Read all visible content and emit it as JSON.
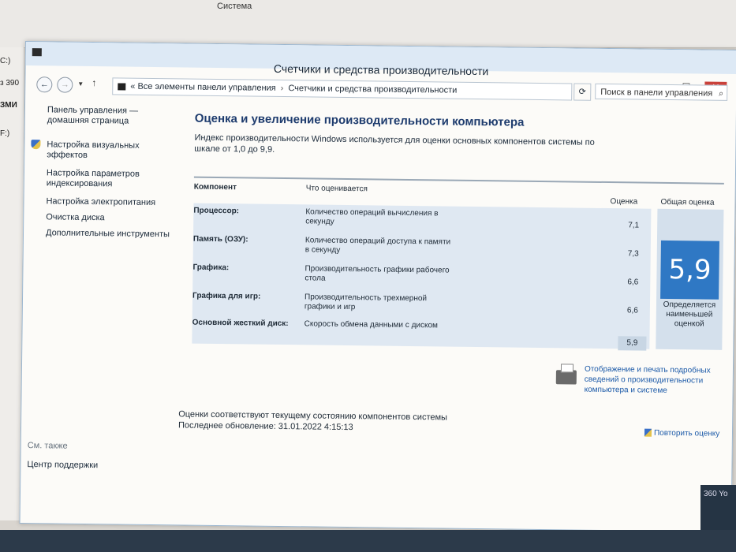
{
  "background": {
    "title": "Система",
    "fragments": [
      "C:)",
      "з 390",
      "ЗМИ",
      "F:)"
    ]
  },
  "corner_badge": "360 Yo",
  "window": {
    "title": "Счетчики и средства производительности",
    "controls": {
      "minimize": "–",
      "maximize": "☐",
      "close": "✕"
    }
  },
  "nav": {
    "back": "←",
    "forward": "→",
    "up": "↑",
    "breadcrumb_prefix": "«",
    "breadcrumb": [
      "Все элементы панели управления",
      "Счетчики и средства производительности"
    ],
    "search_placeholder": "Поиск в панели управления"
  },
  "sidebar": {
    "home": "Панель управления — домашняя страница",
    "items": [
      "Настройка визуальных эффектов",
      "Настройка параметров индексирования",
      "Настройка электропитания",
      "Очистка диска",
      "Дополнительные инструменты"
    ],
    "see_also": "См. также",
    "support": "Центр поддержки"
  },
  "main": {
    "title": "Оценка и увеличение производительности компьютера",
    "intro": "Индекс производительности Windows используется для оценки основных компонентов системы по шкале от 1,0 до 9,9.",
    "table": {
      "headers": {
        "component": "Компонент",
        "rated": "Что оценивается",
        "score": "Оценка",
        "overall": "Общая оценка"
      },
      "rows": [
        {
          "name": "Процессор:",
          "desc": "Количество операций вычисления в секунду",
          "score": "7,1"
        },
        {
          "name": "Память (ОЗУ):",
          "desc": "Количество операций доступа к памяти в секунду",
          "score": "7,3"
        },
        {
          "name": "Графика:",
          "desc": "Производительность графики рабочего стола",
          "score": "6,6"
        },
        {
          "name": "Графика для игр:",
          "desc": "Производительность трехмерной графики и игр",
          "score": "6,6"
        },
        {
          "name": "Основной жесткий диск:",
          "desc": "Скорость обмена данными с диском",
          "score": "5,9"
        }
      ],
      "overall_score": "5,9",
      "overall_note": "Определяется наименьшей оценкой"
    },
    "print_link": "Отображение и печать подробных сведений о производительности компьютера и системе",
    "status_line1": "Оценки соответствуют текущему состоянию компонентов системы",
    "status_line2": "Последнее обновление: 31.01.2022 4:15:13",
    "rerun_link": "Повторить оценку"
  }
}
